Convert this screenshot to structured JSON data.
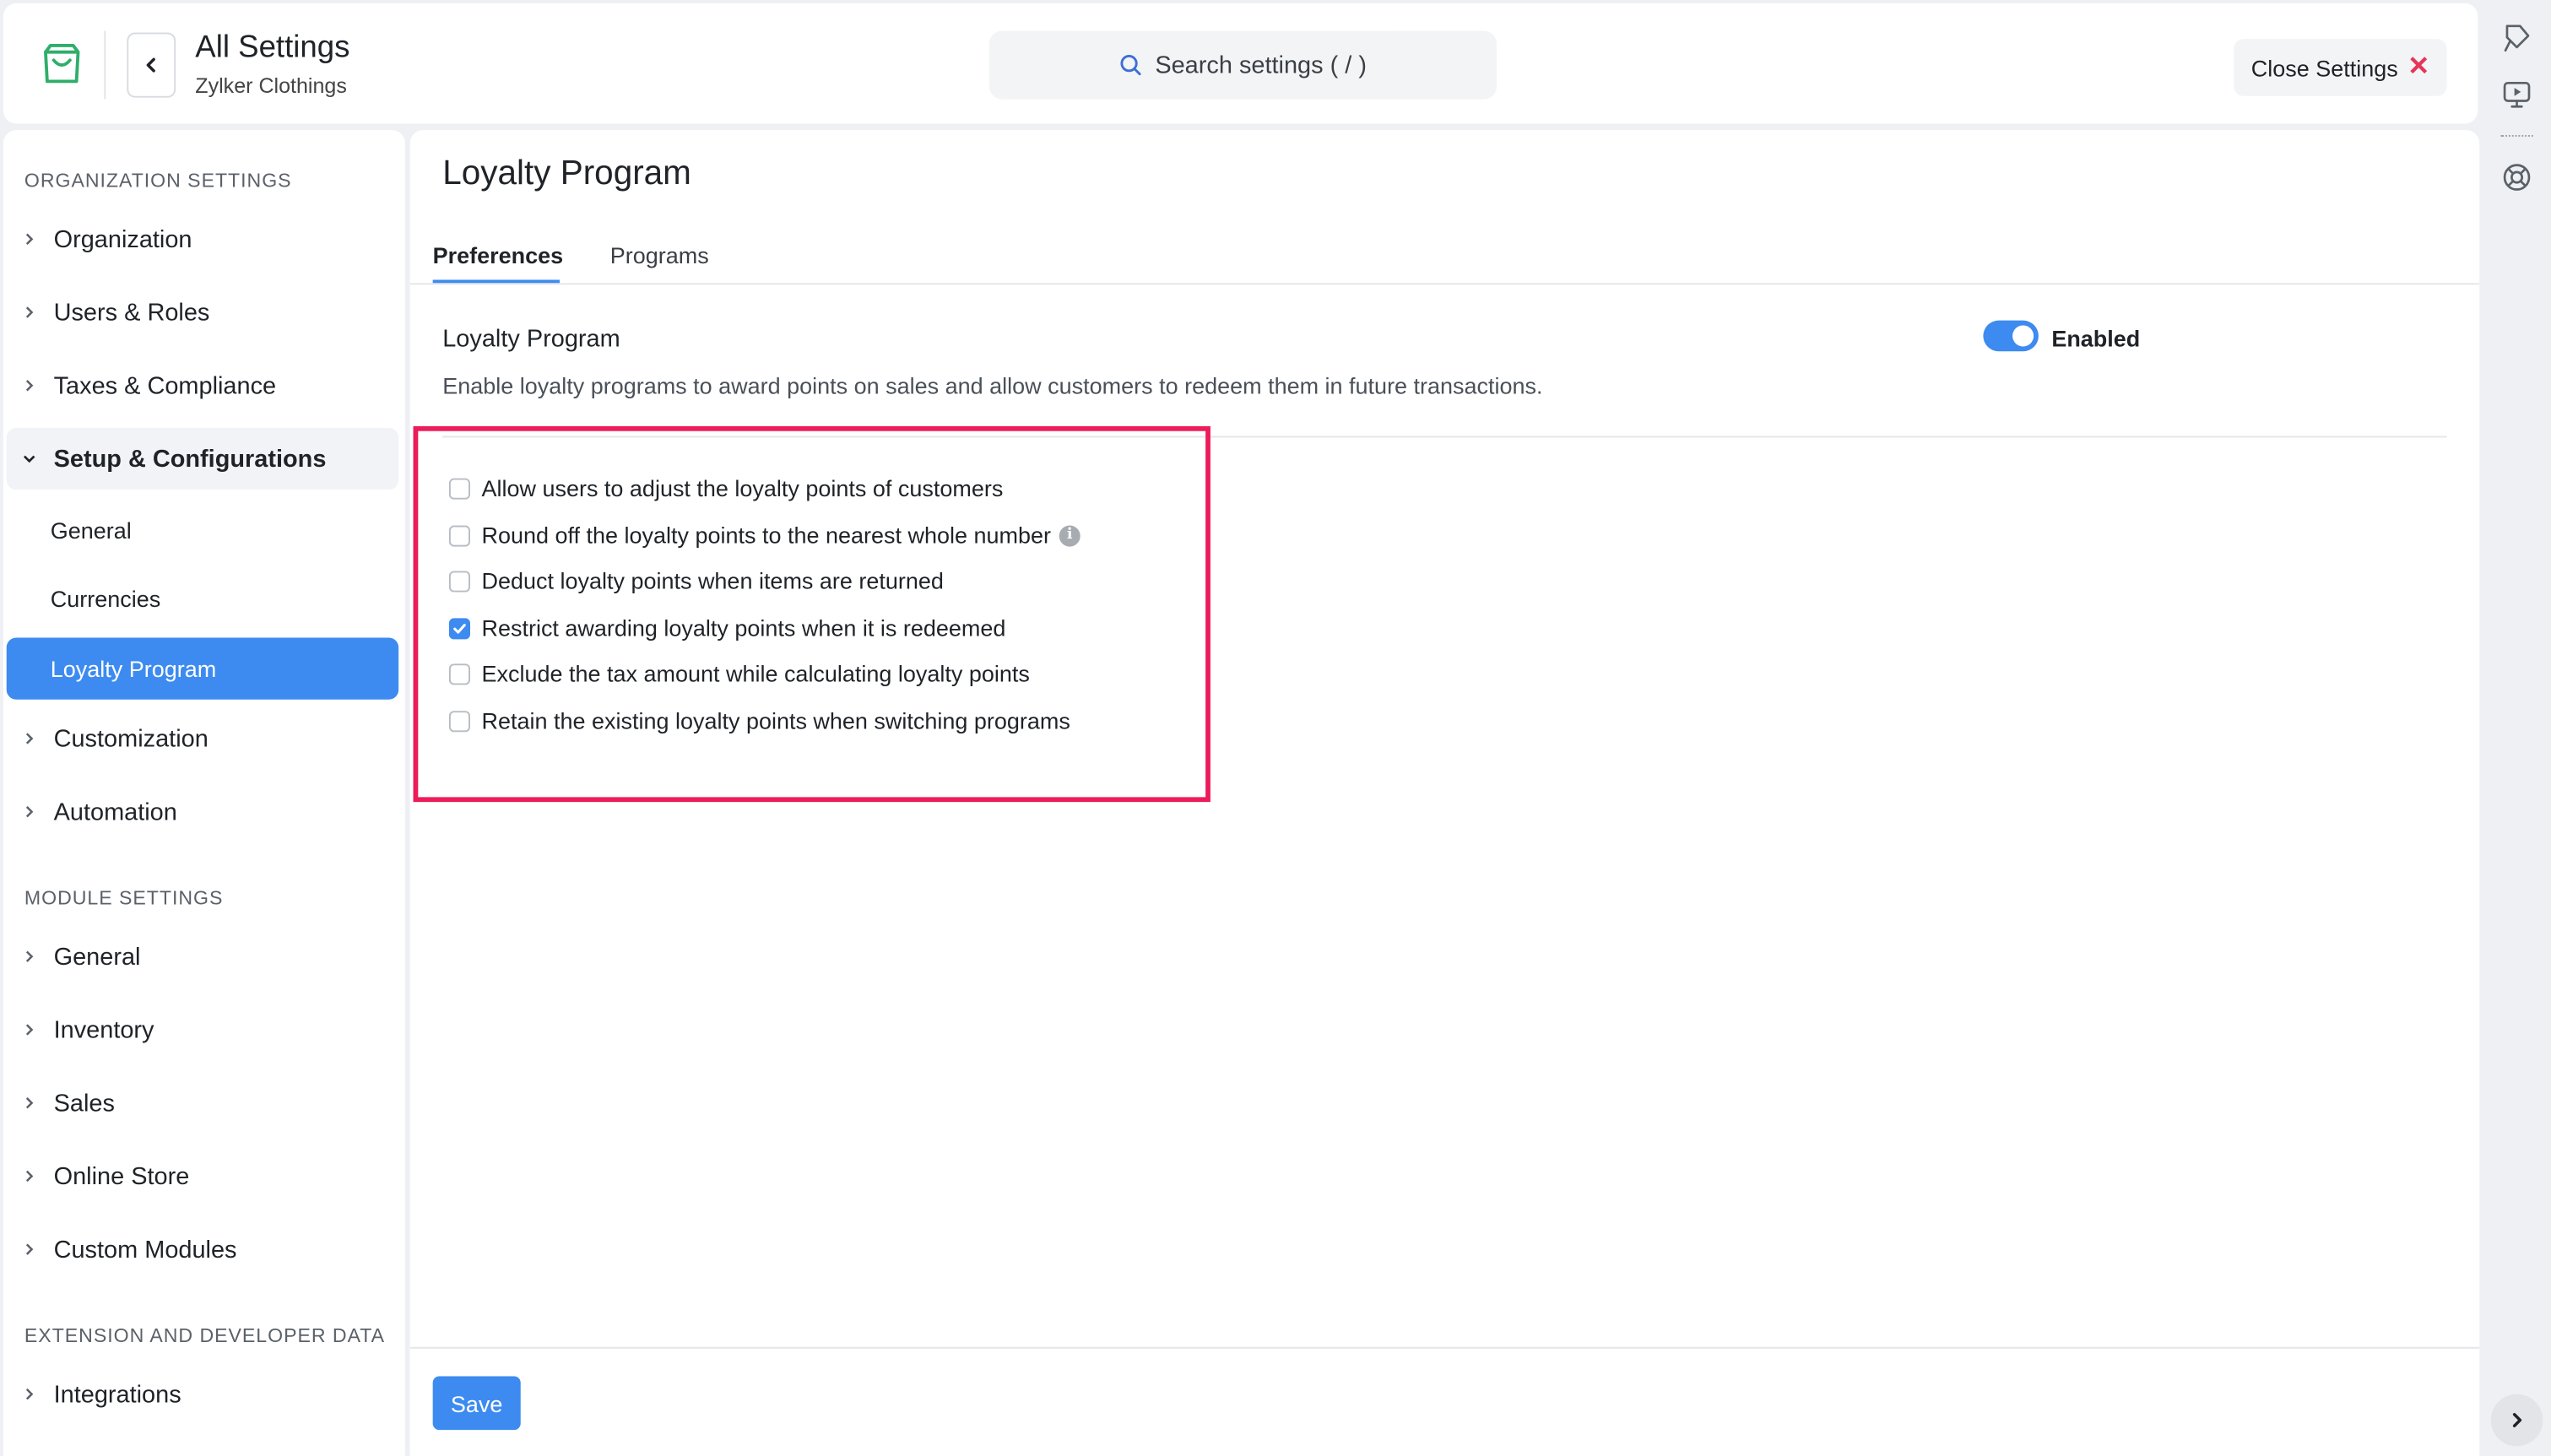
{
  "header": {
    "title": "All Settings",
    "subtitle": "Zylker Clothings",
    "search_placeholder": "Search settings ( / )",
    "close_label": "Close Settings"
  },
  "sidebar": {
    "sections": [
      {
        "heading": "ORGANIZATION SETTINGS",
        "items": [
          {
            "label": "Organization"
          },
          {
            "label": "Users & Roles"
          },
          {
            "label": "Taxes & Compliance"
          },
          {
            "label": "Setup & Configurations",
            "expanded": true,
            "children": [
              {
                "label": "General"
              },
              {
                "label": "Currencies"
              },
              {
                "label": "Loyalty Program",
                "active": true
              }
            ]
          },
          {
            "label": "Customization"
          },
          {
            "label": "Automation"
          }
        ]
      },
      {
        "heading": "MODULE SETTINGS",
        "items": [
          {
            "label": "General"
          },
          {
            "label": "Inventory"
          },
          {
            "label": "Sales"
          },
          {
            "label": "Online Store"
          },
          {
            "label": "Custom Modules"
          }
        ]
      },
      {
        "heading": "EXTENSION AND DEVELOPER DATA",
        "items": [
          {
            "label": "Integrations"
          }
        ]
      }
    ]
  },
  "main": {
    "title": "Loyalty Program",
    "tabs": [
      {
        "label": "Preferences",
        "active": true
      },
      {
        "label": "Programs",
        "active": false
      }
    ],
    "section": {
      "title": "Loyalty Program",
      "description": "Enable loyalty programs to award points on sales and allow customers to redeem them in future transactions.",
      "toggle_label": "Enabled",
      "toggle_on": true
    },
    "options": [
      {
        "label": "Allow users to adjust the loyalty points of customers",
        "checked": false
      },
      {
        "label": "Round off the loyalty points to the nearest whole number",
        "checked": false,
        "info_icon": true
      },
      {
        "label": "Deduct loyalty points when items are returned",
        "checked": false
      },
      {
        "label": "Restrict awarding loyalty points when it is redeemed",
        "checked": true
      },
      {
        "label": "Exclude the tax amount while calculating loyalty points",
        "checked": false
      },
      {
        "label": "Retain the existing loyalty points when switching programs",
        "checked": false
      }
    ],
    "save_label": "Save"
  },
  "colors": {
    "accent": "#3d8bf0",
    "highlight": "#ec1c5b",
    "close_x": "#e5365a",
    "logo": "#2fae6a"
  },
  "icons": {
    "logo": "shopping-bag-icon",
    "back": "chevron-left-icon",
    "search": "search-icon",
    "close": "close-icon",
    "rail": [
      "marker-icon",
      "video-tutorial-icon",
      "help-lifebuoy-icon"
    ],
    "expand": "chevron-right-icon",
    "info": "info-icon"
  }
}
